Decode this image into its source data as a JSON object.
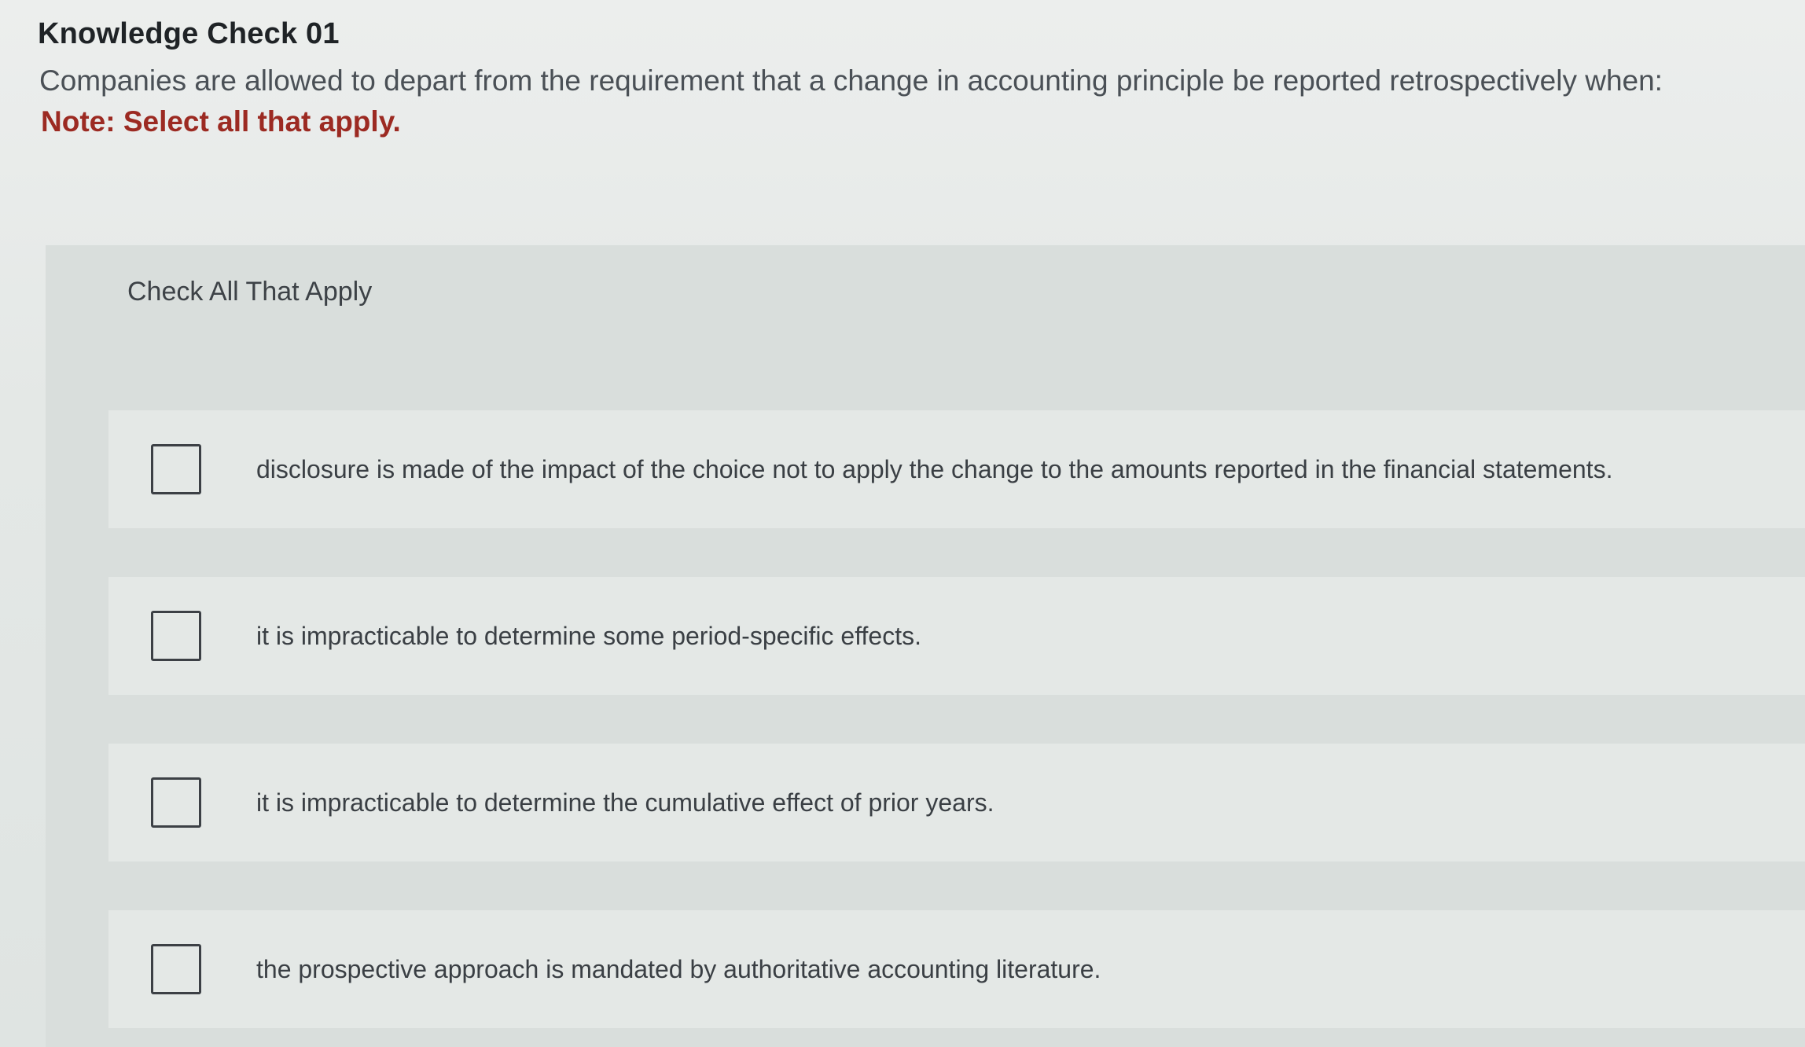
{
  "header": {
    "title": "Knowledge Check 01",
    "question": "Companies are allowed to depart from the requirement that a change in accounting principle be reported retrospectively when:",
    "note": "Note: Select all that apply."
  },
  "panel": {
    "heading": "Check All That Apply",
    "options": [
      {
        "label": "disclosure is made of the impact of the choice not to apply the change to the amounts reported in the financial statements.",
        "checked": false
      },
      {
        "label": "it is impracticable to determine some period-specific effects.",
        "checked": false
      },
      {
        "label": "it is impracticable to determine the cumulative effect of prior years.",
        "checked": false
      },
      {
        "label": "the prospective approach is mandated by authoritative accounting literature.",
        "checked": false
      }
    ]
  },
  "colors": {
    "note": "#9c2a22",
    "title": "#1f2326",
    "text": "#4a5056",
    "panel": "#d9dedc"
  }
}
